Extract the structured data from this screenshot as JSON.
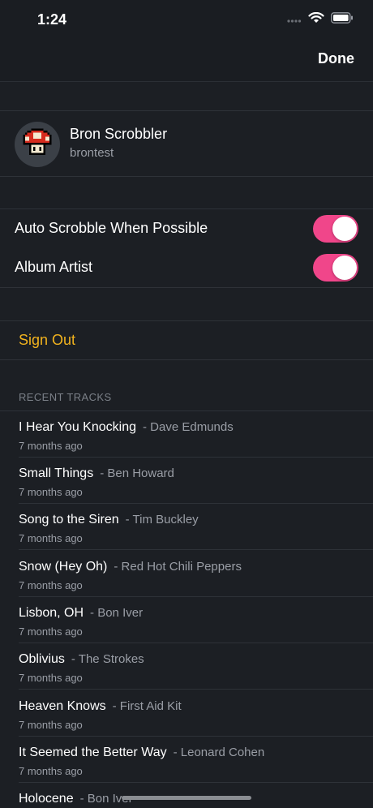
{
  "status": {
    "time": "1:24"
  },
  "nav": {
    "done_label": "Done"
  },
  "profile": {
    "name": "Bron Scrobbler",
    "username": "brontest"
  },
  "settings": {
    "auto_scrobble": {
      "label": "Auto Scrobble When Possible",
      "on": true
    },
    "album_artist": {
      "label": "Album Artist",
      "on": true
    }
  },
  "account": {
    "sign_out_label": "Sign Out"
  },
  "recent": {
    "header": "RECENT TRACKS",
    "tracks": [
      {
        "title": "I Hear You Knocking",
        "artist": "- Dave Edmunds",
        "time": "7 months ago"
      },
      {
        "title": "Small Things",
        "artist": "- Ben Howard",
        "time": "7 months ago"
      },
      {
        "title": "Song to the Siren",
        "artist": "- Tim Buckley",
        "time": "7 months ago"
      },
      {
        "title": "Snow (Hey Oh)",
        "artist": "- Red Hot Chili Peppers",
        "time": "7 months ago"
      },
      {
        "title": "Lisbon, OH",
        "artist": "- Bon Iver",
        "time": "7 months ago"
      },
      {
        "title": "Oblivius",
        "artist": "- The Strokes",
        "time": "7 months ago"
      },
      {
        "title": "Heaven Knows",
        "artist": "- First Aid Kit",
        "time": "7 months ago"
      },
      {
        "title": "It Seemed the Better Way",
        "artist": "- Leonard Cohen",
        "time": "7 months ago"
      },
      {
        "title": "Holocene",
        "artist": "- Bon Iver",
        "time": ""
      }
    ]
  },
  "colors": {
    "accent_toggle": "#f0468a",
    "sign_out": "#f2b31e",
    "background": "#1c1f24"
  },
  "icons": [
    "signal-icon",
    "wifi-icon",
    "battery-icon",
    "mushroom-avatar-icon"
  ]
}
